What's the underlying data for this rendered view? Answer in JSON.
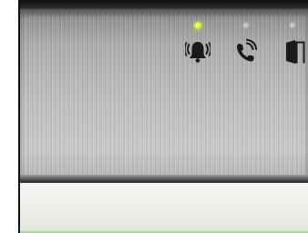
{
  "indicators": [
    {
      "icon": "alarm-bell-icon",
      "status": "on",
      "led_color": "#cde02a"
    },
    {
      "icon": "phone-call-icon",
      "status": "off",
      "led_color": "#9d9d9d"
    },
    {
      "icon": "door-open-icon",
      "status": "off",
      "led_color": "#9d9d9d"
    }
  ],
  "display": {
    "text": ""
  },
  "colors": {
    "panel": "#c4c4c4",
    "icon": "#1a1a1a",
    "display_background": "#eeeeea",
    "display_glow": "#a8d49c"
  }
}
